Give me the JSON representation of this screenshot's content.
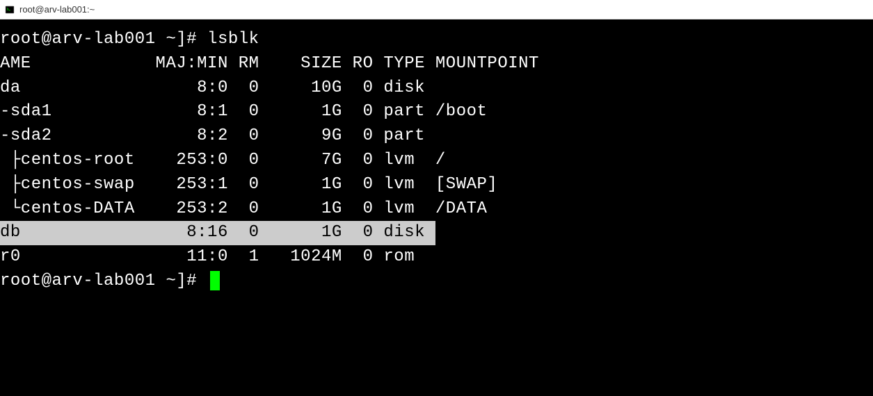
{
  "window": {
    "title": "root@arv-lab001:~"
  },
  "terminal": {
    "prompt1": "root@arv-lab001 ~]# ",
    "command1": "lsblk",
    "header": {
      "name": "AME",
      "majmin": "MAJ:MIN",
      "rm": "RM",
      "size": "SIZE",
      "ro": "RO",
      "type": "TYPE",
      "mountpoint": "MOUNTPOINT"
    },
    "rows": [
      {
        "name": "da",
        "majmin": "8:0",
        "rm": "0",
        "size": "10G",
        "ro": "0",
        "type": "disk",
        "mountpoint": "",
        "highlight": false
      },
      {
        "name": "-sda1",
        "majmin": "8:1",
        "rm": "0",
        "size": "1G",
        "ro": "0",
        "type": "part",
        "mountpoint": "/boot",
        "highlight": false
      },
      {
        "name": "-sda2",
        "majmin": "8:2",
        "rm": "0",
        "size": "9G",
        "ro": "0",
        "type": "part",
        "mountpoint": "",
        "highlight": false
      },
      {
        "name": " ├centos-root",
        "majmin": "253:0",
        "rm": "0",
        "size": "7G",
        "ro": "0",
        "type": "lvm",
        "mountpoint": "/",
        "highlight": false
      },
      {
        "name": " ├centos-swap",
        "majmin": "253:1",
        "rm": "0",
        "size": "1G",
        "ro": "0",
        "type": "lvm",
        "mountpoint": "[SWAP]",
        "highlight": false
      },
      {
        "name": " └centos-DATA",
        "majmin": "253:2",
        "rm": "0",
        "size": "1G",
        "ro": "0",
        "type": "lvm",
        "mountpoint": "/DATA",
        "highlight": false
      },
      {
        "name": "db",
        "majmin": "8:16",
        "rm": "0",
        "size": "1G",
        "ro": "0",
        "type": "disk",
        "mountpoint": "",
        "highlight": true
      },
      {
        "name": "r0",
        "majmin": "11:0",
        "rm": "1",
        "size": "1024M",
        "ro": "0",
        "type": "rom",
        "mountpoint": "",
        "highlight": false
      }
    ],
    "prompt2": "root@arv-lab001 ~]# "
  }
}
